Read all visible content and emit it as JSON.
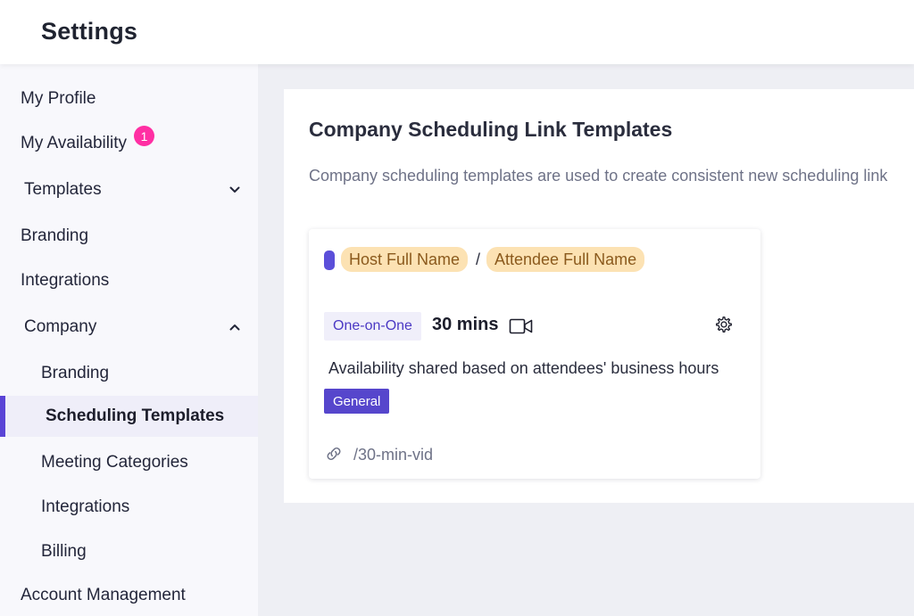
{
  "header": {
    "title": "Settings"
  },
  "sidebar": {
    "my_profile": "My Profile",
    "my_availability": "My Availability",
    "availability_badge": "1",
    "templates": "Templates",
    "branding": "Branding",
    "integrations": "Integrations",
    "company": "Company",
    "company_branding": "Branding",
    "scheduling_templates": "Scheduling Templates",
    "meeting_categories": "Meeting Categories",
    "company_integrations": "Integrations",
    "billing": "Billing",
    "account_management": "Account Management"
  },
  "main": {
    "title": "Company Scheduling Link Templates",
    "description": "Company scheduling templates are used to create consistent new scheduling link",
    "card": {
      "color": "#5b4fd9",
      "host_chip": "Host Full Name",
      "separator": "/",
      "attendee_chip": "Attendee Full Name",
      "meeting_type": "One-on-One",
      "duration": "30 mins",
      "availability": "Availability shared based on attendees' business hours",
      "category": "General",
      "slug": "/30-min-vid"
    }
  },
  "colors": {
    "accent": "#5a44d6",
    "badge": "#ff2fa3",
    "chip_bg": "#fce2b3",
    "chip_text": "#8b5a1d"
  },
  "icons": [
    "chevron-down-icon",
    "chevron-up-icon",
    "video-icon",
    "gear-icon",
    "link-icon"
  ]
}
